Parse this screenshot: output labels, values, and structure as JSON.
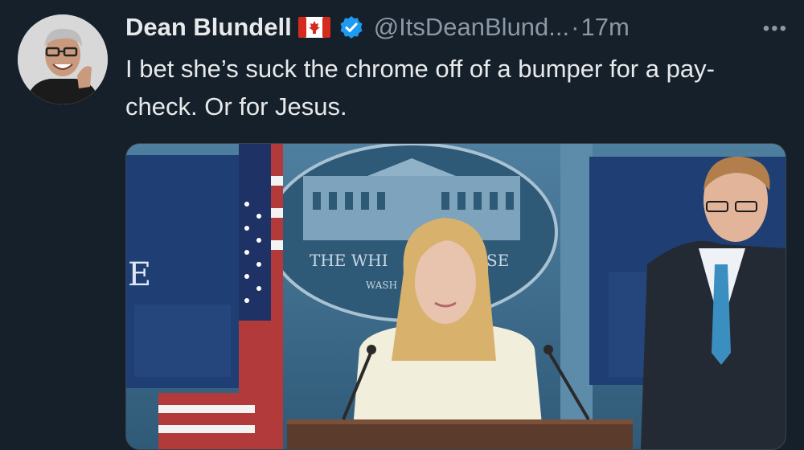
{
  "tweet": {
    "author_name": "Dean Blundell",
    "flag_emoji": "canada-flag",
    "handle": "@ItsDeanBlund...",
    "separator": "·",
    "time": "17m",
    "more_label": "•••",
    "text": "I bet she’s suck the chrome off of a bumper for a pay-check. Or for Jesus."
  },
  "media": {
    "seal_line1": "THE WHI",
    "seal_line1b": "SE",
    "seal_line2": "WASH",
    "left_screen_text": "E"
  },
  "colors": {
    "background": "#15202b",
    "text_primary": "#e7e9ea",
    "text_secondary": "#8b98a5",
    "verified_blue": "#1d9bf0"
  }
}
